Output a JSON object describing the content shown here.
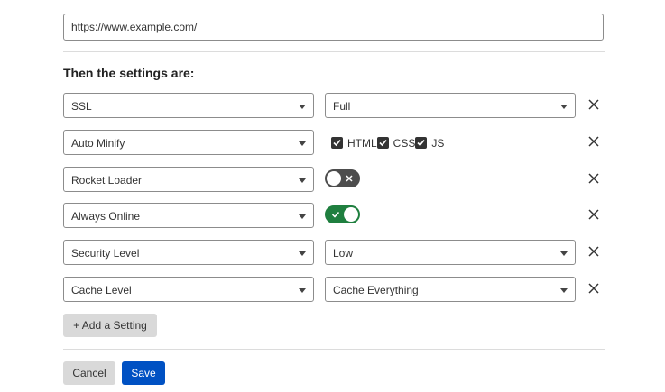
{
  "url_field": {
    "value": "https://www.example.com/"
  },
  "settings_heading": "Then the settings are:",
  "rows": [
    {
      "setting": "SSL",
      "value": "Full"
    },
    {
      "setting": "Auto Minify",
      "checks": [
        {
          "label": "HTML",
          "checked": true
        },
        {
          "label": "CSS",
          "checked": true
        },
        {
          "label": "JS",
          "checked": true
        }
      ]
    },
    {
      "setting": "Rocket Loader",
      "toggle": "off"
    },
    {
      "setting": "Always Online",
      "toggle": "on"
    },
    {
      "setting": "Security Level",
      "value": "Low"
    },
    {
      "setting": "Cache Level",
      "value": "Cache Everything"
    }
  ],
  "add_setting_label": "+ Add a Setting",
  "cancel_label": "Cancel",
  "save_label": "Save",
  "colors": {
    "primary": "#0051c3",
    "toggle_on": "#1f7f3f",
    "toggle_off": "#4d4d4d"
  }
}
